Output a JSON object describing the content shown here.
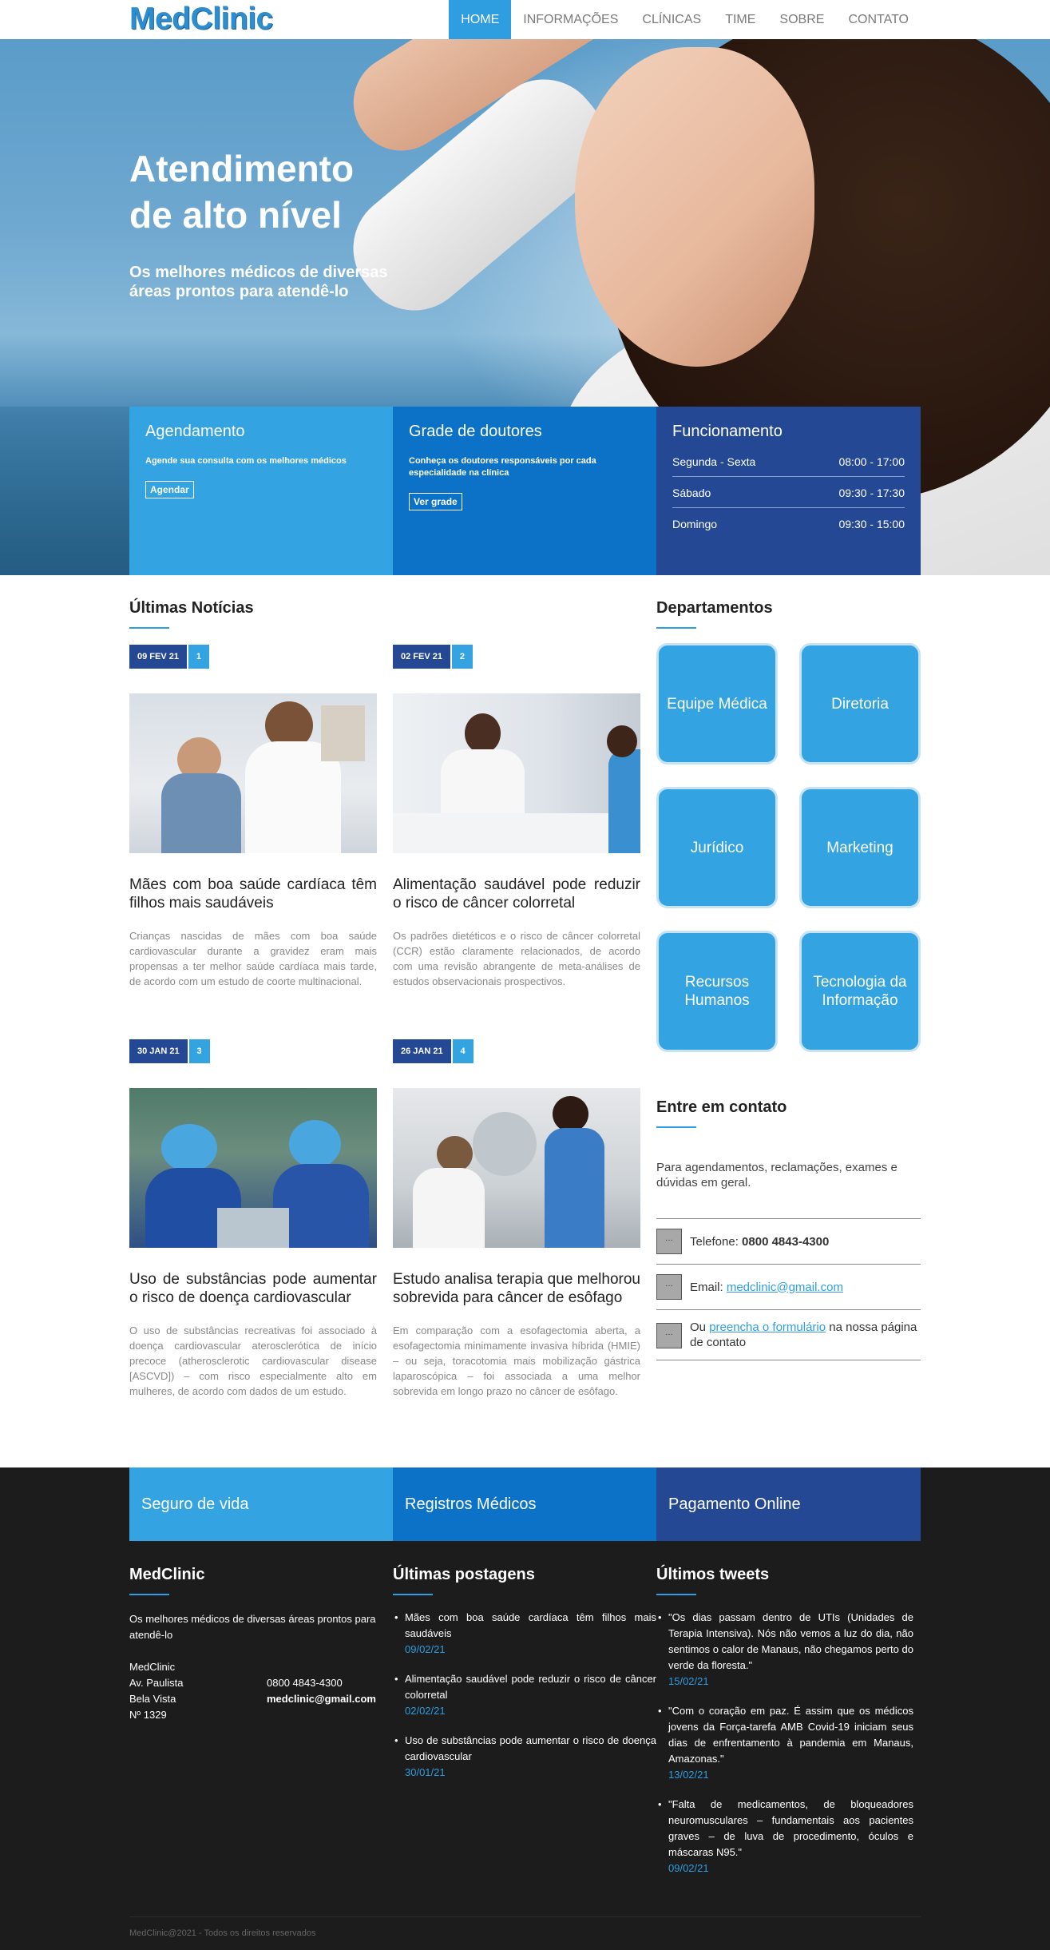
{
  "header": {
    "logo": "MedClinic",
    "nav": [
      "HOME",
      "INFORMAÇÕES",
      "CLÍNICAS",
      "TIME",
      "SOBRE",
      "CONTATO"
    ]
  },
  "hero": {
    "title_line1": "Atendimento",
    "title_line2": "de alto nível",
    "subtitle": "Os melhores médicos de diversas áreas prontos para atendê-lo"
  },
  "boxes": {
    "agendamento": {
      "title": "Agendamento",
      "text": "Agende sua consulta com os melhores médicos",
      "button": "Agendar"
    },
    "grade": {
      "title": "Grade de doutores",
      "text": "Conheça os doutores responsáveis por cada especialidade na clínica",
      "button": "Ver grade"
    },
    "funcionamento": {
      "title": "Funcionamento",
      "rows": [
        {
          "day": "Segunda - Sexta",
          "time": "08:00 - 17:00"
        },
        {
          "day": "Sábado",
          "time": "09:30 - 17:30"
        },
        {
          "day": "Domingo",
          "time": "09:30 - 15:00"
        }
      ]
    }
  },
  "news": {
    "title": "Últimas Notícias",
    "items": [
      {
        "date": "09 FEV 21",
        "num": "1",
        "title": "Mães com boa saúde cardíaca têm filhos mais saudáveis",
        "text": "Crianças nascidas de mães com boa saúde cardiovascular durante a gravidez eram mais propensas a ter melhor saúde cardíaca mais tarde, de acordo com um estudo de coorte multinacional."
      },
      {
        "date": "02 FEV 21",
        "num": "2",
        "title": "Alimentação saudável pode reduzir o risco de câncer colorretal",
        "text": "Os padrões dietéticos e o risco de câncer colorretal (CCR) estão claramente relacionados, de acordo com uma revisão abrangente de meta-análises de estudos observacionais prospectivos."
      },
      {
        "date": "30 JAN 21",
        "num": "3",
        "title": "Uso de substâncias pode aumentar o risco de doença cardiovascular",
        "text": "O uso de substâncias recreativas foi associado à doença cardiovascular aterosclerótica de início precoce (atherosclerotic cardiovascular disease [ASCVD]) – com risco especialmente alto em mulheres, de acordo com dados de um estudo."
      },
      {
        "date": "26 JAN 21",
        "num": "4",
        "title": "Estudo analisa terapia que melhorou sobrevida para câncer de esôfago",
        "text": "Em comparação com a esofagectomia aberta, a esofagectomia minimamente invasiva híbrida (HMIE) – ou seja, toracotomia mais mobilização gástrica laparoscópica – foi associada a uma melhor sobrevida em longo prazo no câncer de esôfago."
      }
    ]
  },
  "departments": {
    "title": "Departamentos",
    "items": [
      "Equipe Médica",
      "Diretoria",
      "Jurídico",
      "Marketing",
      "Recursos Humanos",
      "Tecnologia da Informação"
    ]
  },
  "contact": {
    "title": "Entre em contato",
    "intro": "Para agendamentos, reclamações, exames e dúvidas em geral.",
    "phone_label": "Telefone: ",
    "phone": "0800 4843-4300",
    "email_label": "Email: ",
    "email": "medclinic@gmail.com",
    "form_pre": "Ou ",
    "form_link": "preencha o formulário",
    "form_post": " na nossa página de contato"
  },
  "footer": {
    "bands": [
      "Seguro de vida",
      "Registros Médicos",
      "Pagamento Online"
    ],
    "about": {
      "title": "MedClinic",
      "text": "Os melhores médicos de diversas áreas prontos para atendê-lo",
      "name": "MedClinic",
      "addr1": "Av. Paulista",
      "addr2": "Bela Vista",
      "addr3": "Nº 1329",
      "phone": "0800 4843-4300",
      "email": "medclinic@gmail.com"
    },
    "posts": {
      "title": "Últimas postagens",
      "items": [
        {
          "text": "Mães com boa saúde cardíaca têm filhos mais saudáveis",
          "date": "09/02/21"
        },
        {
          "text": "Alimentação saudável pode reduzir o risco de câncer colorretal",
          "date": "02/02/21"
        },
        {
          "text": "Uso de substâncias pode aumentar o risco de doença cardiovascular",
          "date": "30/01/21"
        }
      ]
    },
    "tweets": {
      "title": "Últimos tweets",
      "items": [
        {
          "text": "\"Os dias passam dentro de UTIs (Unidades de Terapia Intensiva). Nós não vemos a luz do dia, não sentimos o calor de Manaus, não chegamos perto do verde da floresta.\"",
          "date": "15/02/21"
        },
        {
          "text": "\"Com o coração em paz. É assim que os médicos jovens da Força-tarefa AMB Covid-19 iniciam seus dias de enfrentamento à pandemia em Manaus, Amazonas.\"",
          "date": "13/02/21"
        },
        {
          "text": "\"Falta de medicamentos, de bloqueadores neuromusculares – fundamentais aos pacientes graves – de luva de procedimento, óculos e máscaras N95.\"",
          "date": "09/02/21"
        }
      ]
    },
    "copyright": "MedClinic@2021 - Todos os direitos reservados"
  },
  "colors": {
    "accent": "#2e9ee0",
    "blue_mid": "#0c72c8",
    "blue_dark": "#244894",
    "footer_bg": "#1c1c1d"
  }
}
